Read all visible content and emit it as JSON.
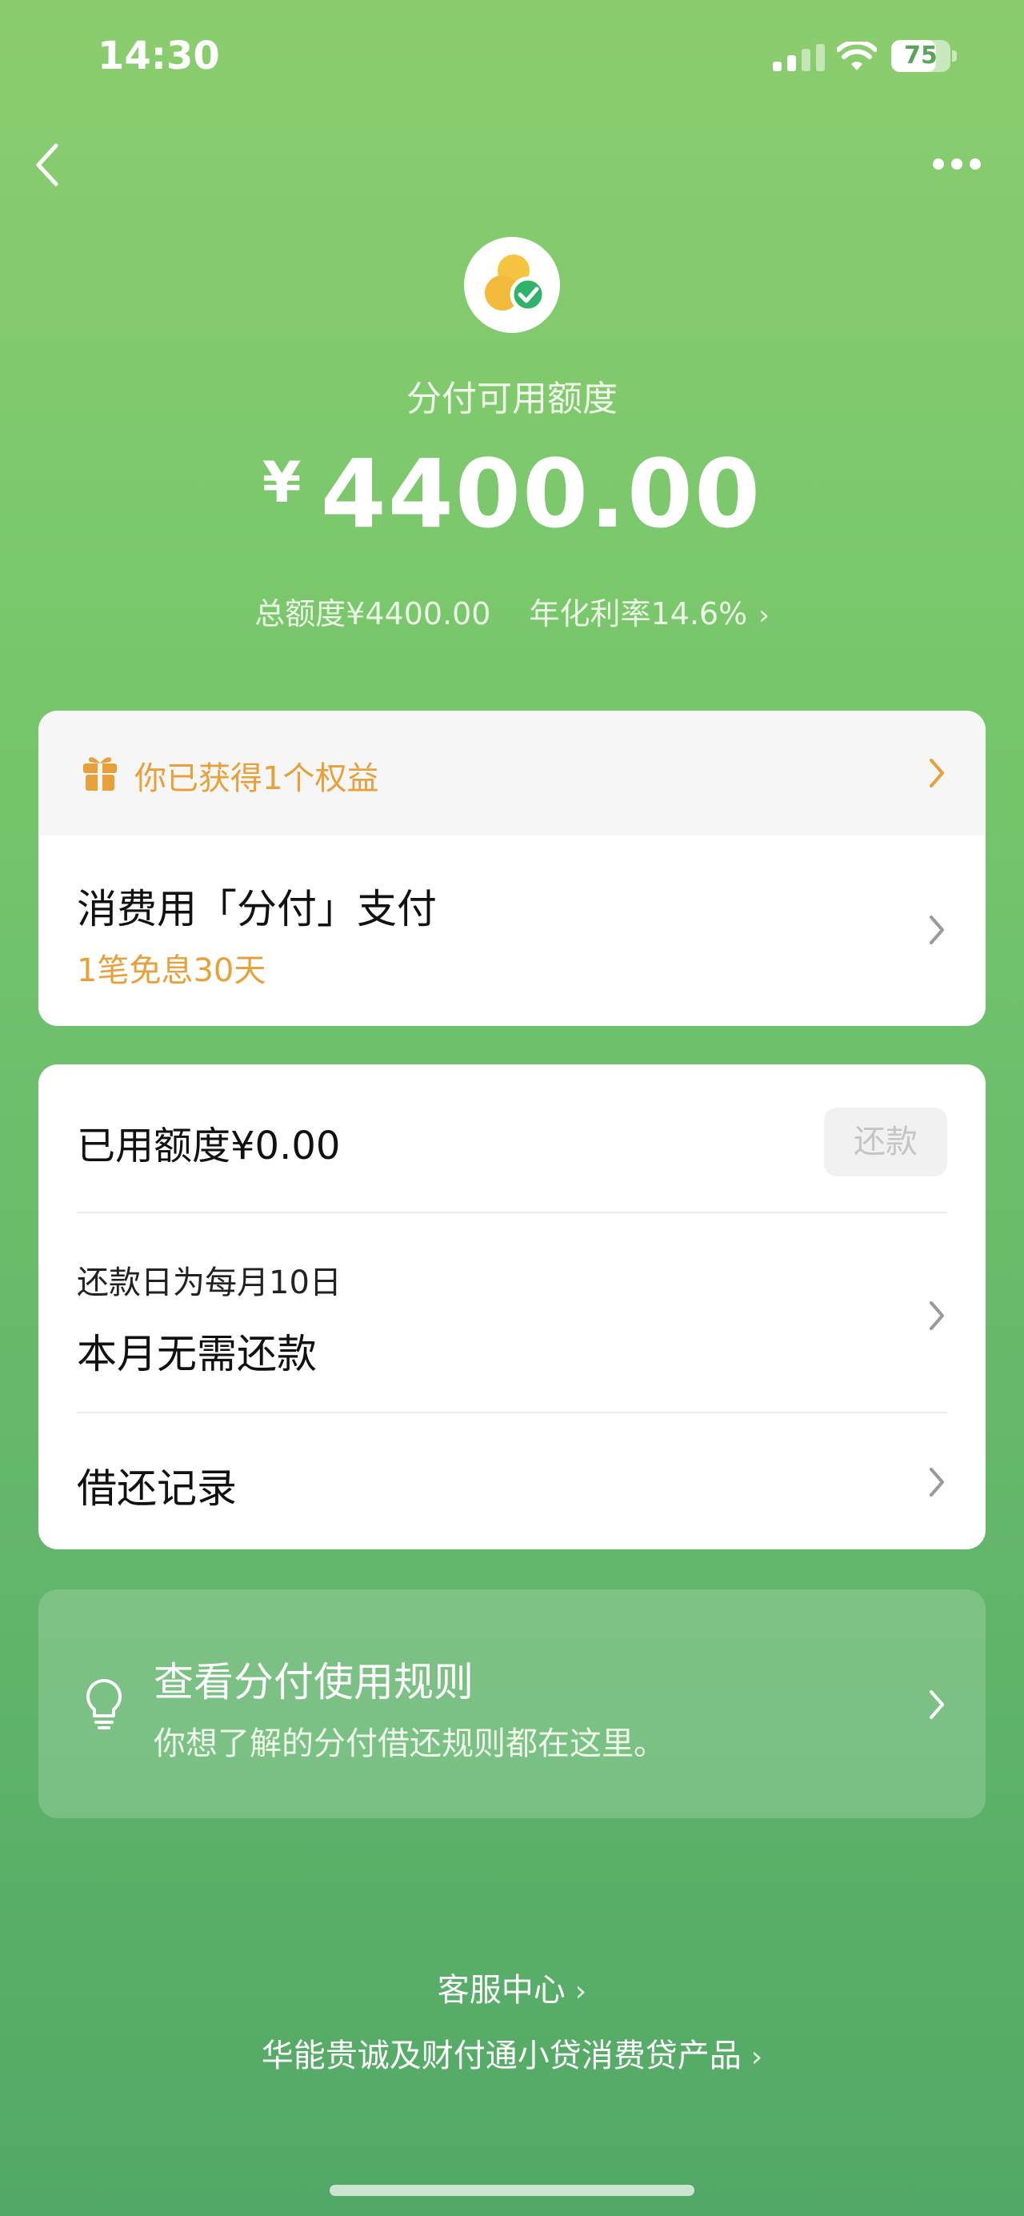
{
  "status_bar": {
    "time": "14:30",
    "battery": "75",
    "battery_level_percent": 75
  },
  "header": {
    "credit_label": "分付可用额度",
    "currency_symbol": "¥",
    "available_amount": "4400.00",
    "total_limit": "总额度¥4400.00",
    "annual_rate": "年化利率14.6%"
  },
  "benefit_card": {
    "benefit_text": "你已获得1个权益",
    "pay_title": "消费用「分付」支付",
    "pay_subtitle": "1笔免息30天"
  },
  "repayment_card": {
    "used_amount": "已用额度¥0.00",
    "repay_button": "还款",
    "due_label": "还款日为每月10日",
    "due_status": "本月无需还款",
    "records_label": "借还记录"
  },
  "rules_card": {
    "title": "查看分付使用规则",
    "subtitle": "你想了解的分付借还规则都在这里。"
  },
  "footer": {
    "service_center": "客服中心",
    "product_info": "华能贵诚及财付通小贷消费贷产品"
  },
  "colors": {
    "accent_orange": "#e8a13a",
    "bg_green_top": "#8bcd6e",
    "bg_green_bottom": "#52a866"
  }
}
